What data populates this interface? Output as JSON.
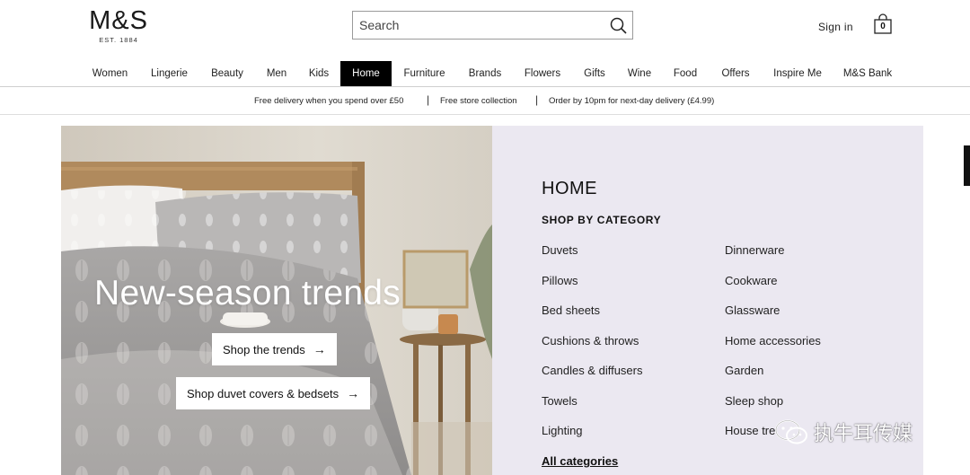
{
  "header": {
    "logo_text": "M&S",
    "logo_subtext": "EST. 1884",
    "search_placeholder": "Search",
    "signin_label": "Sign in",
    "bag_count": "0"
  },
  "nav": {
    "items": [
      {
        "label": "Women"
      },
      {
        "label": "Lingerie"
      },
      {
        "label": "Beauty"
      },
      {
        "label": "Men"
      },
      {
        "label": "Kids"
      },
      {
        "label": "Home",
        "active": true
      },
      {
        "label": "Furniture"
      },
      {
        "label": "Brands"
      },
      {
        "label": "Flowers"
      },
      {
        "label": "Gifts"
      },
      {
        "label": "Wine"
      },
      {
        "label": "Food"
      },
      {
        "label": "Offers"
      },
      {
        "label": "Inspire Me"
      },
      {
        "label": "M&S Bank"
      }
    ]
  },
  "promo": {
    "items": [
      "Free delivery when you spend over £50",
      "Free store collection",
      "Order by 10pm for next-day delivery (£4.99)"
    ],
    "separator": "|"
  },
  "hero": {
    "title": "New-season trends",
    "button_trends": "Shop the trends",
    "button_duvet": "Shop duvet covers & bedsets",
    "arrow": "→"
  },
  "menu": {
    "title": "HOME",
    "subtitle": "SHOP BY CATEGORY",
    "left_column": [
      "Duvets",
      "Pillows",
      "Bed sheets",
      "Cushions & throws",
      "Candles & diffusers",
      "Towels",
      "Lighting"
    ],
    "right_column": [
      "Dinnerware",
      "Cookware",
      "Glassware",
      "Home accessories",
      "Garden",
      "Sleep shop",
      "House tre"
    ],
    "all_categories": "All categories"
  },
  "watermark": {
    "text": "执牛耳传媒"
  },
  "colors": {
    "nav_active_bg": "#000000",
    "menu_panel_bg": "#ebe8f1",
    "hero_bg": "#d8d2c7"
  }
}
